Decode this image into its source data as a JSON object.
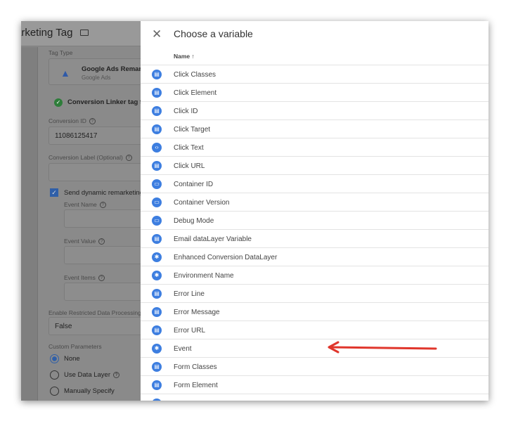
{
  "tag_editor": {
    "title": "arketing Tag",
    "tag_type_label": "Tag Type",
    "tag_type_name": "Google Ads Remark",
    "tag_type_vendor": "Google Ads",
    "linker_notice": "Conversion Linker tag fo",
    "conversion_id_label": "Conversion ID",
    "conversion_id_value": "11086125417",
    "conversion_label_label": "Conversion Label (Optional)",
    "send_dynamic_label": "Send dynamic remarketing",
    "event_name_label": "Event Name",
    "event_value_label": "Event Value",
    "event_items_label": "Event Items",
    "restricted_label": "Enable Restricted Data Processing",
    "restricted_value": "False",
    "custom_params_label": "Custom Parameters",
    "radio_none": "None",
    "radio_data_layer": "Use Data Layer",
    "radio_manual": "Manually Specify"
  },
  "panel": {
    "close_icon": "close-icon",
    "title": "Choose a variable",
    "column_header": "Name ↑",
    "rows": [
      {
        "label": "Click Classes",
        "icon": "doc"
      },
      {
        "label": "Click Element",
        "icon": "doc"
      },
      {
        "label": "Click ID",
        "icon": "doc"
      },
      {
        "label": "Click Target",
        "icon": "doc"
      },
      {
        "label": "Click Text",
        "icon": "code"
      },
      {
        "label": "Click URL",
        "icon": "doc"
      },
      {
        "label": "Container ID",
        "icon": "window"
      },
      {
        "label": "Container Version",
        "icon": "window"
      },
      {
        "label": "Debug Mode",
        "icon": "window"
      },
      {
        "label": "Email dataLayer Variable",
        "icon": "doc"
      },
      {
        "label": "Enhanced Conversion DataLayer",
        "icon": "gear"
      },
      {
        "label": "Environment Name",
        "icon": "gear"
      },
      {
        "label": "Error Line",
        "icon": "doc"
      },
      {
        "label": "Error Message",
        "icon": "doc"
      },
      {
        "label": "Error URL",
        "icon": "doc"
      },
      {
        "label": "Event",
        "icon": "gear"
      },
      {
        "label": "Form Classes",
        "icon": "doc"
      },
      {
        "label": "Form Element",
        "icon": "doc"
      },
      {
        "label": "",
        "icon": "doc"
      }
    ]
  },
  "colors": {
    "accent": "#3d7ee0",
    "arrow": "#e0362c"
  }
}
